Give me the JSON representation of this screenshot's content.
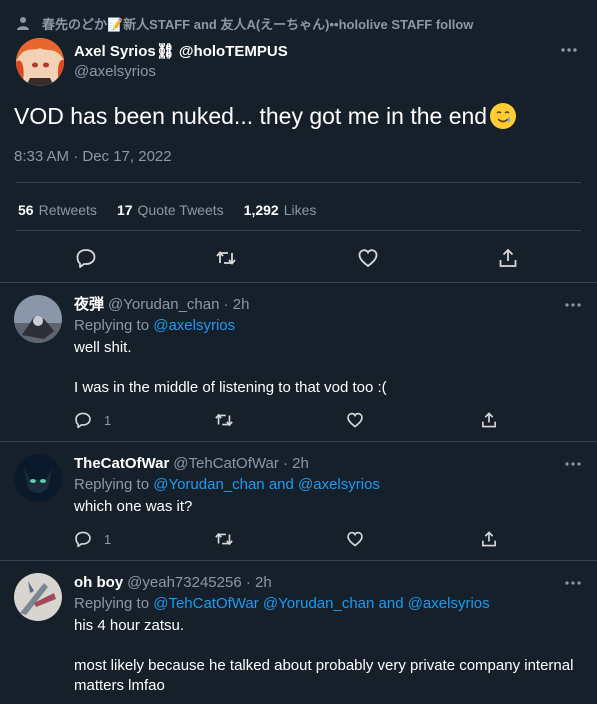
{
  "social_context": {
    "text": "春先のどか📝新人STAFF and 友人A(えーちゃん)••hololive STAFF follow"
  },
  "main_tweet": {
    "display_name": "Axel Syrios⛓ @holoTEMPUS",
    "handle": "@axelsyrios",
    "text": "VOD has been nuked... they got me in the end",
    "emoji": "smiling-face-with-tear",
    "timestamp": "8:33 AM · Dec 17, 2022",
    "stats": {
      "retweets_count": "56",
      "retweets_label": "Retweets",
      "quotes_count": "17",
      "quotes_label": "Quote Tweets",
      "likes_count": "1,292",
      "likes_label": "Likes"
    }
  },
  "replies": [
    {
      "display_name": "夜弾",
      "handle": "@Yorudan_chan · 2h",
      "replying_prefix": "Replying to ",
      "replying_to": "@axelsyrios",
      "body": [
        "well shit.",
        "I was in the middle of listening to that vod too :("
      ],
      "reply_count": "1"
    },
    {
      "display_name": "TheCatOfWar",
      "handle": "@TehCatOfWar · 2h",
      "replying_prefix": "Replying to ",
      "replying_to": "@Yorudan_chan and @axelsyrios",
      "body": [
        "which one was it?"
      ],
      "reply_count": "1"
    },
    {
      "display_name": "oh boy",
      "handle": "@yeah73245256 · 2h",
      "replying_prefix": "Replying to ",
      "replying_to": "@TehCatOfWar @Yorudan_chan and @axelsyrios",
      "body": [
        "his 4 hour zatsu.",
        "most likely because he talked about probably very private company internal matters lmfao"
      ],
      "reply_count": ""
    }
  ],
  "colors": {
    "background": "#15202b",
    "text_primary": "#ffffff",
    "text_secondary": "#8b98a5",
    "link": "#1d9bf0",
    "divider": "#38444d"
  }
}
